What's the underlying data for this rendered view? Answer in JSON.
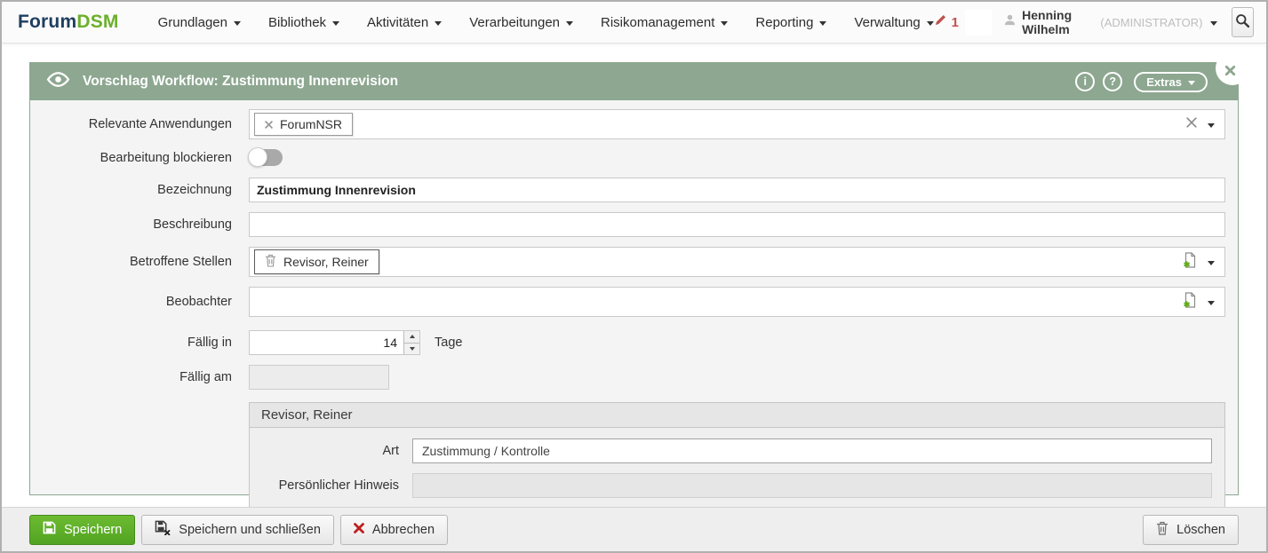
{
  "navbar": {
    "logo_part1": "Forum",
    "logo_part2": "DSM",
    "items": [
      "Grundlagen",
      "Bibliothek",
      "Aktivitäten",
      "Verarbeitungen",
      "Risikomanagement",
      "Reporting",
      "Verwaltung"
    ],
    "edit_count": "1",
    "user_name": "Henning Wilhelm",
    "user_role": "(ADMINISTRATOR)"
  },
  "panel": {
    "title": "Vorschlag Workflow: Zustimmung Innenrevision",
    "info_label": "i",
    "help_label": "?",
    "extras_label": "Extras"
  },
  "form": {
    "relevante_anwendungen": {
      "label": "Relevante Anwendungen",
      "tag": "ForumNSR"
    },
    "bearbeitung_blockieren": {
      "label": "Bearbeitung blockieren",
      "state": "off"
    },
    "bezeichnung": {
      "label": "Bezeichnung",
      "value": "Zustimmung Innenrevision"
    },
    "beschreibung": {
      "label": "Beschreibung",
      "value": ""
    },
    "betroffene_stellen": {
      "label": "Betroffene Stellen",
      "tag": "Revisor, Reiner"
    },
    "beobachter": {
      "label": "Beobachter"
    },
    "faellig_in": {
      "label": "Fällig in",
      "value": "14",
      "suffix": "Tage"
    },
    "faellig_am": {
      "label": "Fällig am",
      "value": ""
    },
    "section": {
      "title": "Revisor, Reiner",
      "art": {
        "label": "Art",
        "value": "Zustimmung / Kontrolle"
      },
      "hinweis": {
        "label": "Persönlicher Hinweis",
        "value": ""
      }
    }
  },
  "footer": {
    "save": "Speichern",
    "save_close": "Speichern und schließen",
    "cancel": "Abbrechen",
    "delete": "Löschen"
  },
  "colors": {
    "header_green": "#8da790",
    "logo_navy": "#1f3e60",
    "logo_green": "#6cb02c",
    "save_button_green": "#52a322",
    "alert_red": "#c0504f",
    "panel_body_gray": "#f4f4f4"
  }
}
